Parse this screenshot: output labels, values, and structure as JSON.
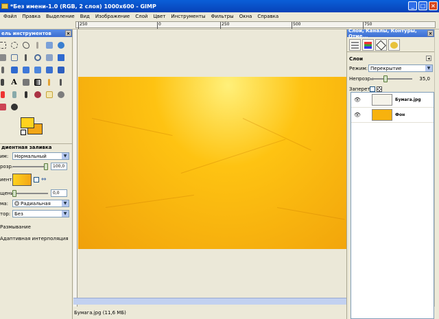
{
  "window": {
    "title": "*Без имени-1.0 (RGB, 2 слоя) 1000x600 - GIMP",
    "buttons": {
      "minimize": "_",
      "maximize": "□",
      "close": "×"
    }
  },
  "menu": [
    "Файл",
    "Правка",
    "Выделение",
    "Вид",
    "Изображение",
    "Слой",
    "Цвет",
    "Инструменты",
    "Фильтры",
    "Окна",
    "Справка"
  ],
  "ruler": {
    "labels": [
      "250",
      "0",
      "250",
      "500",
      "750"
    ]
  },
  "toolbox": {
    "title": "ель инструментов",
    "colors": {
      "foreground": "#ffd21e",
      "background": "#f3a617"
    },
    "options": {
      "title": "диентная заливка",
      "mode_label": "им:",
      "mode_value": "Нормальный",
      "opacity_label": "розр.:",
      "opacity_value": "100,0",
      "opacity_level": 1.0,
      "gradient_label": "иент:",
      "offset_label": "щение:",
      "offset_value": "0,0",
      "offset_level": 0.0,
      "shape_label": "ма:",
      "shape_value": "Радиальная",
      "repeat_label": "тор:",
      "repeat_value": "Без",
      "dithering_label": "Размывание",
      "adaptive_label": "Адаптивная интерполяция"
    }
  },
  "canvas": {
    "image_colors": {
      "light": "#fff07a",
      "mid": "#fec312",
      "dark": "#f0a00a"
    },
    "status": "Бумага.jpg (11,6 МБ)"
  },
  "layers_dock": {
    "title": "Слои, Каналы, Контуры, Отме...",
    "section": "Слои",
    "mode_label": "Режим:",
    "mode_value": "Перекрытие",
    "opacity_label": "Непрозр.:",
    "opacity_value": "35,0",
    "opacity_level": 0.35,
    "lock_label": "Запереть:",
    "layers": [
      {
        "name": "Бумага.jpg",
        "thumb_color": "#f5f3ea"
      },
      {
        "name": "Фон",
        "thumb_color": "#f7b20e"
      }
    ]
  }
}
